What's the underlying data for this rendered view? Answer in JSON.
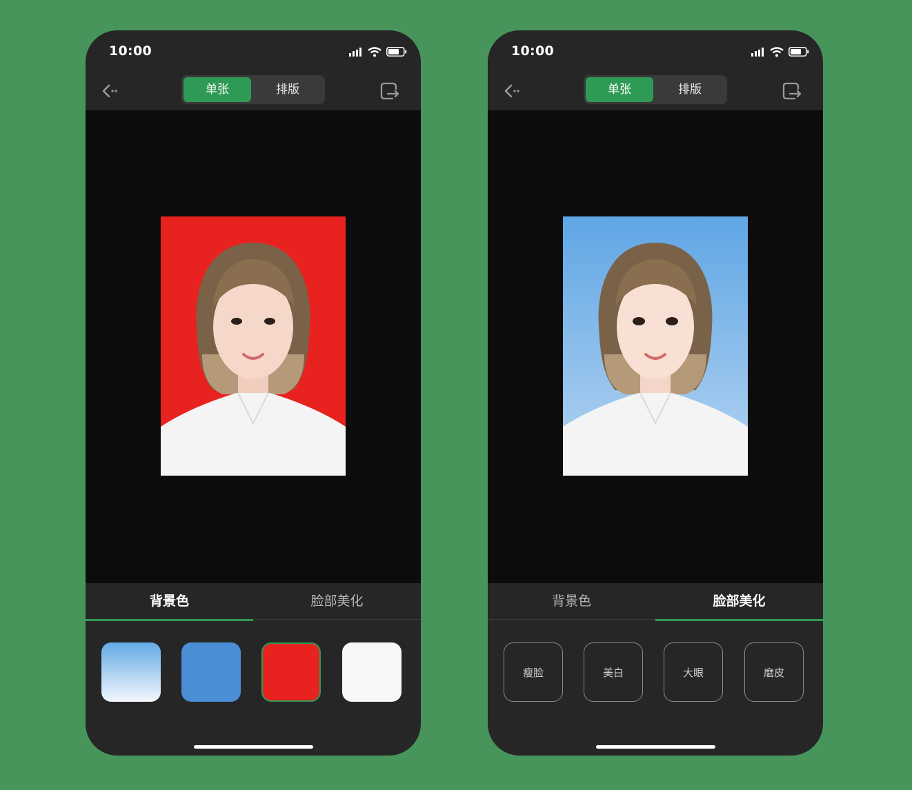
{
  "status_bar": {
    "time": "10:00",
    "icons": [
      "signal-icon",
      "wifi-icon",
      "battery-icon"
    ]
  },
  "nav": {
    "back_icon": "back-arrow-icon",
    "segments": [
      "单张",
      "排版"
    ],
    "selected_segment": "单张",
    "export_icon": "export-icon"
  },
  "accent_color": "#2f9a55",
  "tabs": [
    "背景色",
    "脸部美化"
  ],
  "left_screen": {
    "active_tab": "背景色",
    "photo_background": "#e8231f",
    "background_options": [
      {
        "name": "light-blue-gradient",
        "color": "#63aae6"
      },
      {
        "name": "blue",
        "color": "#4a8ed6"
      },
      {
        "name": "red",
        "color": "#e8231f",
        "selected": true
      },
      {
        "name": "white",
        "color": "#f7f7f7"
      }
    ]
  },
  "right_screen": {
    "active_tab": "脸部美化",
    "photo_background": "#63aae6",
    "beauty_options": [
      "瘦脸",
      "美白",
      "大眼",
      "磨皮"
    ]
  }
}
